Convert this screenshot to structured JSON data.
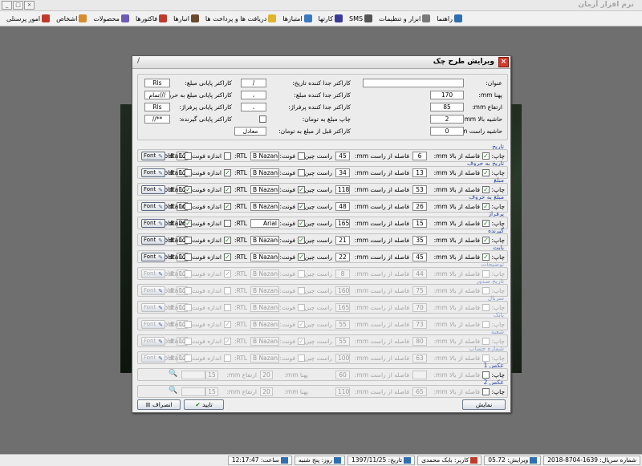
{
  "app": {
    "title": "نرم افزار آرمان",
    "window_buttons": [
      "_",
      "□",
      "×"
    ]
  },
  "menu": [
    {
      "label": "امور پرسنلی",
      "icon": "people-icon",
      "color": "#c0392b"
    },
    {
      "label": "اشخاص",
      "icon": "person-icon",
      "color": "#d98c2b"
    },
    {
      "label": "محصولات",
      "icon": "box-icon",
      "color": "#6f5ab8"
    },
    {
      "label": "فاکتورها",
      "icon": "invoice-icon",
      "color": "#c0392b"
    },
    {
      "label": "انبارها",
      "icon": "warehouse-icon",
      "color": "#6b4a2b"
    },
    {
      "label": "دریافت ها و پرداخت ها",
      "icon": "star-icon",
      "color": "#e0b52b"
    },
    {
      "label": "امتیازها",
      "icon": "medal-icon",
      "color": "#3a7bc0"
    },
    {
      "label": "کارتها",
      "icon": "card-icon",
      "color": "#3a3a9a"
    },
    {
      "label": "SMS",
      "icon": "sms-icon",
      "color": "#555555"
    },
    {
      "label": "ابزار و تنظیمات",
      "icon": "tools-icon",
      "color": "#7a7a7a"
    },
    {
      "label": "راهنما",
      "icon": "help-icon",
      "color": "#2f6fb0"
    }
  ],
  "status": [
    {
      "label": "شماره سریال: 1639-8704-2018",
      "icon": "",
      "color": ""
    },
    {
      "label": "ویرایش: 05.72",
      "icon": "edit-icon",
      "color": "#2f6fb0"
    },
    {
      "label": "کاربر: بابک محمدی",
      "icon": "user-icon",
      "color": "#c0392b"
    },
    {
      "label": "تاریخ: 1397/11/25",
      "icon": "calendar-icon",
      "color": "#2f6fb0"
    },
    {
      "label": "روز: پنج شنبه",
      "icon": "day-icon",
      "color": "#2f6fb0"
    },
    {
      "label": "ساعت: 12:17:47",
      "icon": "clock-icon",
      "color": "#2f6fb0"
    }
  ],
  "dialog": {
    "title": "ویرایش طرح چک",
    "corner": "/",
    "fields": {
      "title_label": "عنوان:",
      "title_value": "",
      "width_label": "پهنا mm:",
      "width_value": "170",
      "height_label": "ارتفاع mm:",
      "height_value": "85",
      "top_margin_label": "حاشیه بالا mm:",
      "top_margin_value": "2",
      "right_margin_label": "حاشیه راست mm:",
      "right_margin_value": "0",
      "date_sep_label": "کاراکتر جدا کننده تاریخ:",
      "date_sep_value": "/",
      "amount_sep_label": "کاراکتر جدا کننده مبلغ:",
      "amount_sep_value": "،",
      "pay_sep_label": "کاراکتر جدا کننده پرفراژ:",
      "pay_sep_value": "،",
      "print_toman_label": "چاپ مبلغ به تومان:",
      "pre_toman_label": "کاراکتر قبل از مبلغ به تومان:",
      "pre_toman_value": "معادل",
      "amount_end_label": "کاراکتر پایانی مبلغ:",
      "amount_end_value": "Rls",
      "amount_words_end_label": "کاراکتر پایانی مبلغ به حروف:",
      "amount_words_end_value": "تمام///",
      "pay_end_label": "کاراکتر پایانی پرفراژ:",
      "pay_end_value": "Rls",
      "payee_end_label": "کاراکتر پایانی گیرنده:",
      "payee_end_value": "//**"
    },
    "row_labels": {
      "print": "چاپ:",
      "from_top": "فاصله از بالا mm:",
      "from_right": "فاصله از راست mm:",
      "rtl_align": "راست چین:",
      "font": "فونت:",
      "rtl": "RTL:",
      "size": "اندازه فونت:",
      "bold": "Bold:",
      "italic": "Italic:",
      "font_btn": "Font",
      "width": "پهنا mm:",
      "height": "ارتفاع mm:"
    },
    "rows": [
      {
        "group": "تاریخ",
        "enabled": true,
        "print": true,
        "top": "6",
        "right": "45",
        "rtl_align": false,
        "font": "B Nazanin",
        "rtl": false,
        "size": "12",
        "bold": false,
        "italic": false
      },
      {
        "group": "تاریخ به حروف",
        "enabled": true,
        "print": true,
        "top": "13",
        "right": "34",
        "rtl_align": false,
        "font": "B Nazanin",
        "rtl": true,
        "size": "12",
        "bold": false,
        "italic": false
      },
      {
        "group": "مبلغ",
        "enabled": true,
        "print": true,
        "top": "53",
        "right": "118",
        "rtl_align": true,
        "font": "B Nazanin",
        "rtl": true,
        "size": "12",
        "bold": true,
        "italic": false
      },
      {
        "group": "مبلغ به حروف",
        "enabled": true,
        "print": true,
        "top": "26",
        "right": "48",
        "rtl_align": true,
        "font": "B Nazanin",
        "rtl": true,
        "size": "10",
        "bold": false,
        "italic": false
      },
      {
        "group": "پرفراژ",
        "enabled": true,
        "print": true,
        "top": "15",
        "right": "165",
        "rtl_align": true,
        "font": "Arial",
        "rtl": false,
        "size": "26",
        "bold": true,
        "italic": false
      },
      {
        "group": "گیرنده",
        "enabled": true,
        "print": true,
        "top": "35",
        "right": "21",
        "rtl_align": true,
        "font": "B Nazanin",
        "rtl": true,
        "size": "12",
        "bold": false,
        "italic": false
      },
      {
        "group": "بابت",
        "enabled": true,
        "print": true,
        "top": "45",
        "right": "22",
        "rtl_align": true,
        "font": "B Nazanin",
        "rtl": true,
        "size": "12",
        "bold": false,
        "italic": false
      },
      {
        "group": "توضیحات",
        "enabled": false,
        "print": false,
        "top": "44",
        "right": "8",
        "rtl_align": false,
        "font": "B Nazanin",
        "rtl": true,
        "size": "12",
        "bold": false,
        "italic": false
      },
      {
        "group": "تاریخ صدور",
        "enabled": false,
        "print": false,
        "top": "75",
        "right": "160",
        "rtl_align": false,
        "font": "B Nazanin",
        "rtl": false,
        "size": "12",
        "bold": false,
        "italic": false
      },
      {
        "group": "سریال",
        "enabled": false,
        "print": false,
        "top": "70",
        "right": "165",
        "rtl_align": false,
        "font": "B Nazanin",
        "rtl": false,
        "size": "12",
        "bold": false,
        "italic": false
      },
      {
        "group": "بانک",
        "enabled": false,
        "print": false,
        "top": "73",
        "right": "55",
        "rtl_align": true,
        "font": "B Nazanin",
        "rtl": true,
        "size": "12",
        "bold": false,
        "italic": false
      },
      {
        "group": "شعبه",
        "enabled": false,
        "print": false,
        "top": "80",
        "right": "55",
        "rtl_align": true,
        "font": "B Nazanin",
        "rtl": true,
        "size": "12",
        "bold": false,
        "italic": false
      },
      {
        "group": "شماره حساب",
        "enabled": false,
        "print": false,
        "top": "63",
        "right": "100",
        "rtl_align": false,
        "font": "B Nazanin",
        "rtl": false,
        "size": "12",
        "bold": false,
        "italic": false
      }
    ],
    "images": [
      {
        "group": "عکس 1",
        "print": false,
        "top": "",
        "right": "60",
        "width": "20",
        "height": "15"
      },
      {
        "group": "عکس 2",
        "print": false,
        "top": "65",
        "right": "110",
        "width": "20",
        "height": "15"
      }
    ],
    "buttons": {
      "preview": "نمایش",
      "ok": "تایید",
      "cancel": "انصراف"
    }
  },
  "colors": {
    "accent": "#2647a8",
    "check": "#1d7a1d",
    "close": "#d43a2c"
  }
}
